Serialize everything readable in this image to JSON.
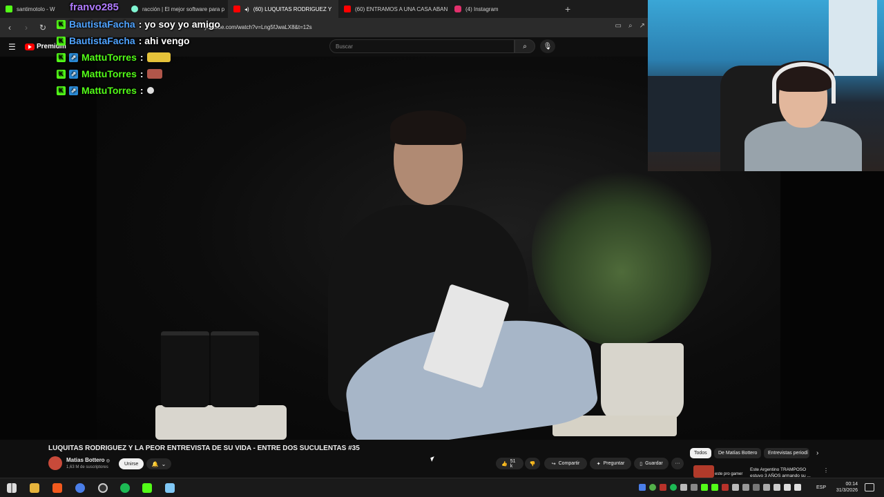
{
  "browser": {
    "tabs": [
      {
        "label": "santimotolo - W",
        "icon": "kick-favicon",
        "color": "#53fc18",
        "active": false
      },
      {
        "label": "racción | El mejor software para p",
        "icon": "streamlabs-favicon",
        "color": "#80f5d2",
        "active": false
      },
      {
        "label": "(60) LUQUITAS RODRIGUEZ Y",
        "icon": "youtube-favicon",
        "color": "#ff0000",
        "active": true,
        "close": "×"
      },
      {
        "label": "(60) ENTRAMOS A UNA CASA ABAN",
        "icon": "youtube-favicon",
        "color": "#ff0000",
        "active": false
      },
      {
        "label": "(4) Instagram",
        "icon": "instagram-favicon",
        "color": "#e1306c",
        "active": false
      }
    ],
    "new_tab": "+",
    "url": "youtube.com/watch?v=Lng5fJwaLX8&t=12s"
  },
  "youtube": {
    "logo_text": "Premium",
    "search_placeholder": "Buscar",
    "video_title": "LUQUITAS RODRIGUEZ Y LA PEOR ENTREVISTA DE SU VIDA - ENTRE DOS SUCULENTAS #35",
    "channel_name": "Matias Bottero",
    "verified_mark": "◎",
    "subscribers": "1,63 M de suscriptores",
    "join_label": "Unirse",
    "likes": "51 k",
    "share_label": "Compartir",
    "ask_label": "Preguntar",
    "save_label": "Guardar",
    "more_label": "···",
    "chips": [
      "Todos",
      "De Matías Bottero",
      "Entrevistas periodí"
    ],
    "chip_next": "›",
    "recommendation": {
      "title": "Este Argentino TRAMPOSO estuvo 3 AÑOS armando su ...",
      "thumb_text": "este pro gamer"
    }
  },
  "chat": [
    {
      "user": "franvo285",
      "message": "",
      "color": "#b07bff",
      "badges": []
    },
    {
      "user": "BautistaFacha",
      "message": ": yo soy yo amigo",
      "color": "#4fa3ff",
      "badges": [
        "kick"
      ]
    },
    {
      "user": "BautistaFacha",
      "message": ": ahi vengo",
      "color": "#4fa3ff",
      "badges": [
        "kick"
      ]
    },
    {
      "user": "MattuTorres",
      "message": " :",
      "color": "#53fc18",
      "badges": [
        "kick",
        "sub"
      ],
      "emote_color": "#e5c23a"
    },
    {
      "user": "MattuTorres",
      "message": " :",
      "color": "#53fc18",
      "badges": [
        "kick",
        "sub"
      ],
      "emote_color": "#b0564a"
    },
    {
      "user": "MattuTorres",
      "message": " :",
      "color": "#53fc18",
      "badges": [
        "kick",
        "sub"
      ],
      "emote_color": "#dddddd"
    }
  ],
  "taskbar": {
    "language": "ESP",
    "time": "00:14",
    "date": "31/3/2026"
  }
}
